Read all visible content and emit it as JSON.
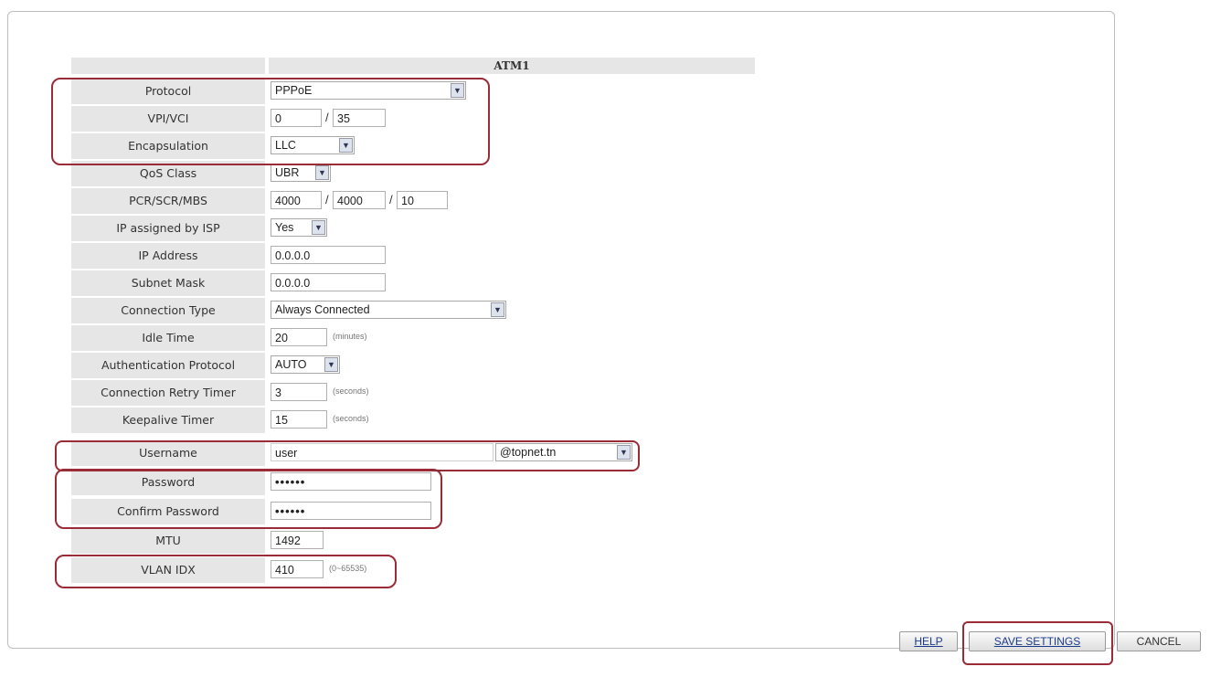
{
  "header": {
    "title": "ATM1"
  },
  "fields": {
    "protocol": {
      "label": "Protocol",
      "value": "PPPoE"
    },
    "vpi_vci": {
      "label": "VPI/VCI",
      "vpi": "0",
      "vci": "35",
      "separator": "/"
    },
    "encapsulation": {
      "label": "Encapsulation",
      "value": "LLC"
    },
    "qos_class": {
      "label": "QoS Class",
      "value": "UBR"
    },
    "pcr_scr_mbs": {
      "label": "PCR/SCR/MBS",
      "pcr": "4000",
      "scr": "4000",
      "mbs": "10",
      "separator": "/"
    },
    "ip_assigned": {
      "label": "IP assigned by ISP",
      "value": "Yes"
    },
    "ip_address": {
      "label": "IP Address",
      "value": "0.0.0.0"
    },
    "subnet_mask": {
      "label": "Subnet Mask",
      "value": "0.0.0.0"
    },
    "connection_type": {
      "label": "Connection Type",
      "value": "Always Connected"
    },
    "idle_time": {
      "label": "Idle Time",
      "value": "20",
      "unit": "(minutes)"
    },
    "auth_protocol": {
      "label": "Authentication Protocol",
      "value": "AUTO"
    },
    "retry_timer": {
      "label": "Connection Retry Timer",
      "value": "3",
      "unit": "(seconds)"
    },
    "keepalive_timer": {
      "label": "Keepalive Timer",
      "value": "15",
      "unit": "(seconds)"
    },
    "username": {
      "label": "Username",
      "value": "user",
      "domain": "@topnet.tn"
    },
    "password": {
      "label": "Password",
      "value": "••••••"
    },
    "confirm_password": {
      "label": "Confirm Password",
      "value": "••••••"
    },
    "mtu": {
      "label": "MTU",
      "value": "1492"
    },
    "vlan_idx": {
      "label": "VLAN IDX",
      "value": "410",
      "unit": "(0~65535)"
    }
  },
  "buttons": {
    "help": "HELP",
    "save": "SAVE SETTINGS",
    "cancel": "CANCEL"
  },
  "colors": {
    "highlight": "#9b2b36",
    "label_bg": "#e6e6e6",
    "link": "#1a3b8a"
  },
  "icons": {
    "dropdown": "chevron-down-icon"
  }
}
